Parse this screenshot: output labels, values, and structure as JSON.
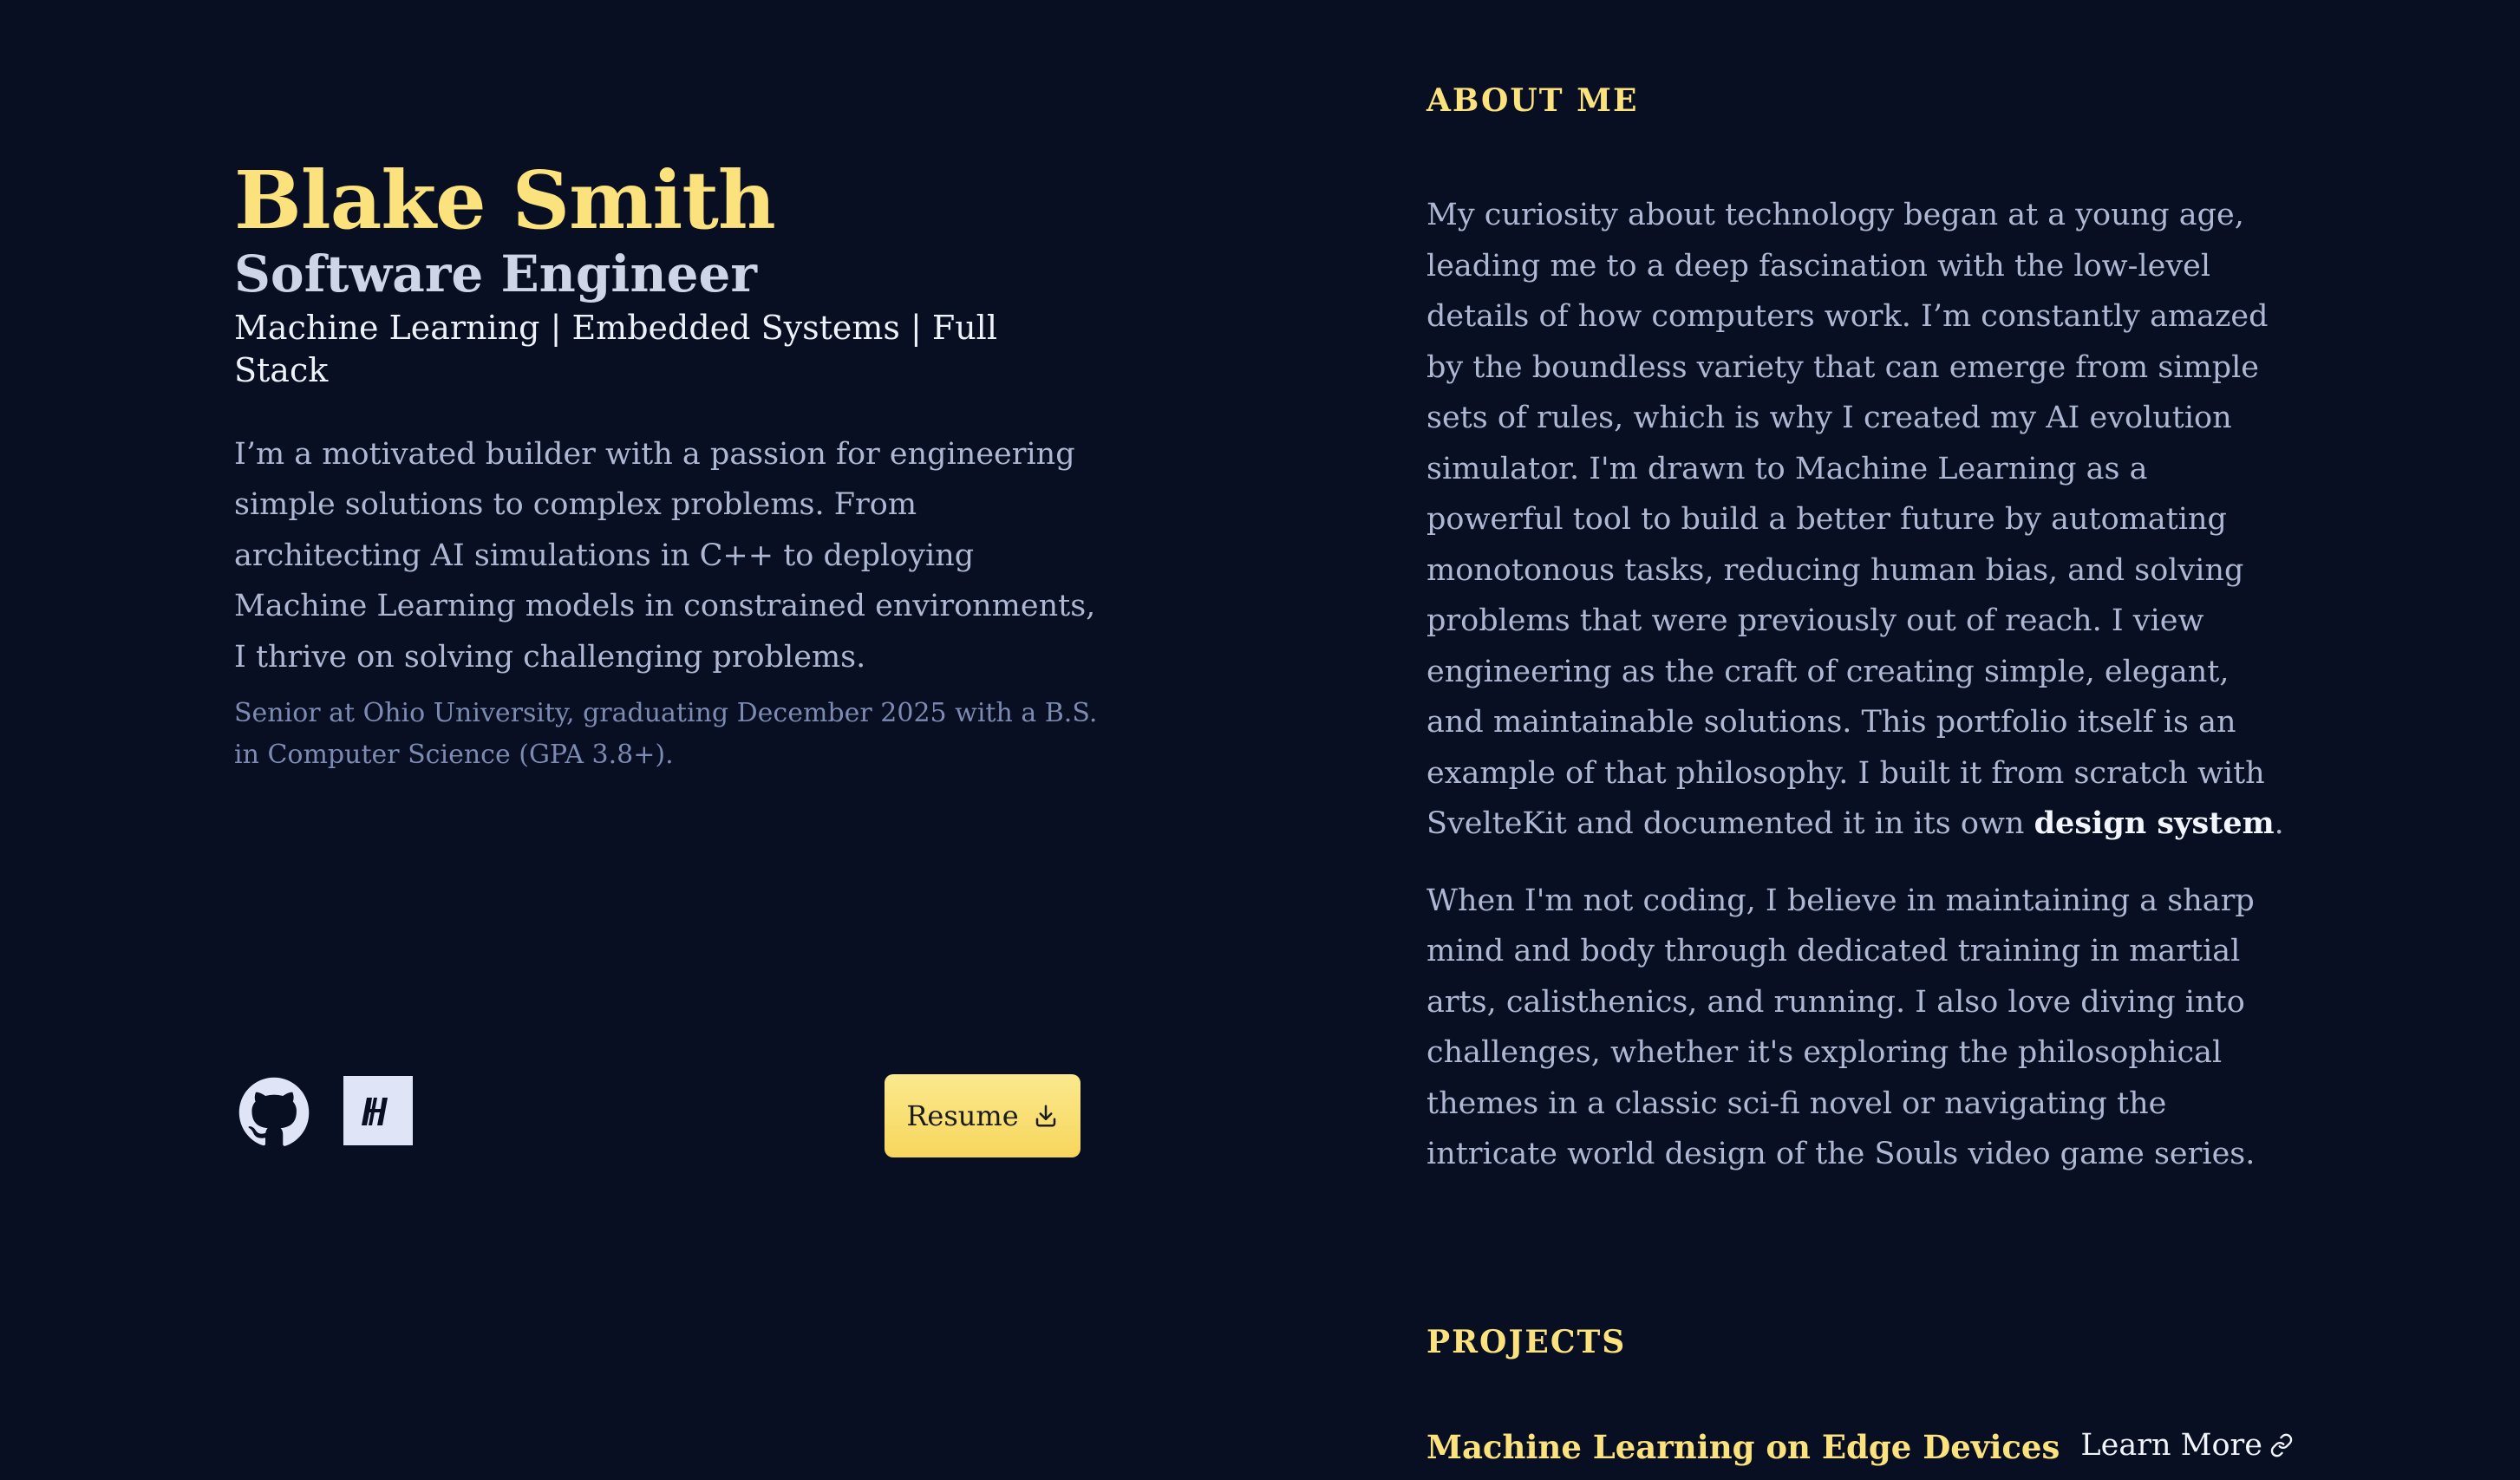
{
  "profile": {
    "name": "Blake Smith",
    "role": "Software Engineer",
    "specialties": "Machine Learning | Embedded Systems | Full Stack",
    "intro": "I’m a motivated builder with a passion for engineering simple solutions to complex problems. From architecting AI simulations in C++ to deploying Machine Learning models in constrained environments, I thrive on solving challenging problems.",
    "education": "Senior at Ohio University, graduating December 2025 with a B.S. in Computer Science (GPA 3.8+)."
  },
  "links": {
    "github_icon": "github-icon",
    "hashnode_icon": "hashnode-icon",
    "resume_label": "Resume",
    "resume_icon": "download-icon"
  },
  "about": {
    "heading": "ABOUT ME",
    "p1": "My curiosity about technology began at a young age, leading me to a deep fascination with the low-level details of how computers work. I’m constantly amazed by the boundless variety that can emerge from simple sets of rules, which is why I created my AI evolution simulator. I'm drawn to Machine Learning as a powerful tool to build a better future by automating monotonous tasks, reducing human bias, and solving problems that were previously out of reach. I view engineering as the craft of creating simple, elegant, and maintainable solutions. This portfolio itself is an example of that philosophy. I built it from scratch with SvelteKit and documented it in its own ",
    "p1_link": "design system",
    "p1_end": ".",
    "p2": "When I'm not coding, I believe in maintaining a sharp mind and body through dedicated training in martial arts, calisthenics, and running. I also love diving into challenges, whether it's exploring the philosophical themes in a classic sci-fi novel or navigating the intricate world design of the Souls video game series."
  },
  "projects": {
    "heading": "PROJECTS",
    "items": [
      {
        "title": "Machine Learning on Edge Devices",
        "link_label": "Learn More",
        "link_icon": "external-link-icon"
      }
    ]
  },
  "colors": {
    "background": "#080f22",
    "accent": "#fbe27d",
    "body_text": "#aeb8d3",
    "muted_text": "#7d8bb2"
  }
}
